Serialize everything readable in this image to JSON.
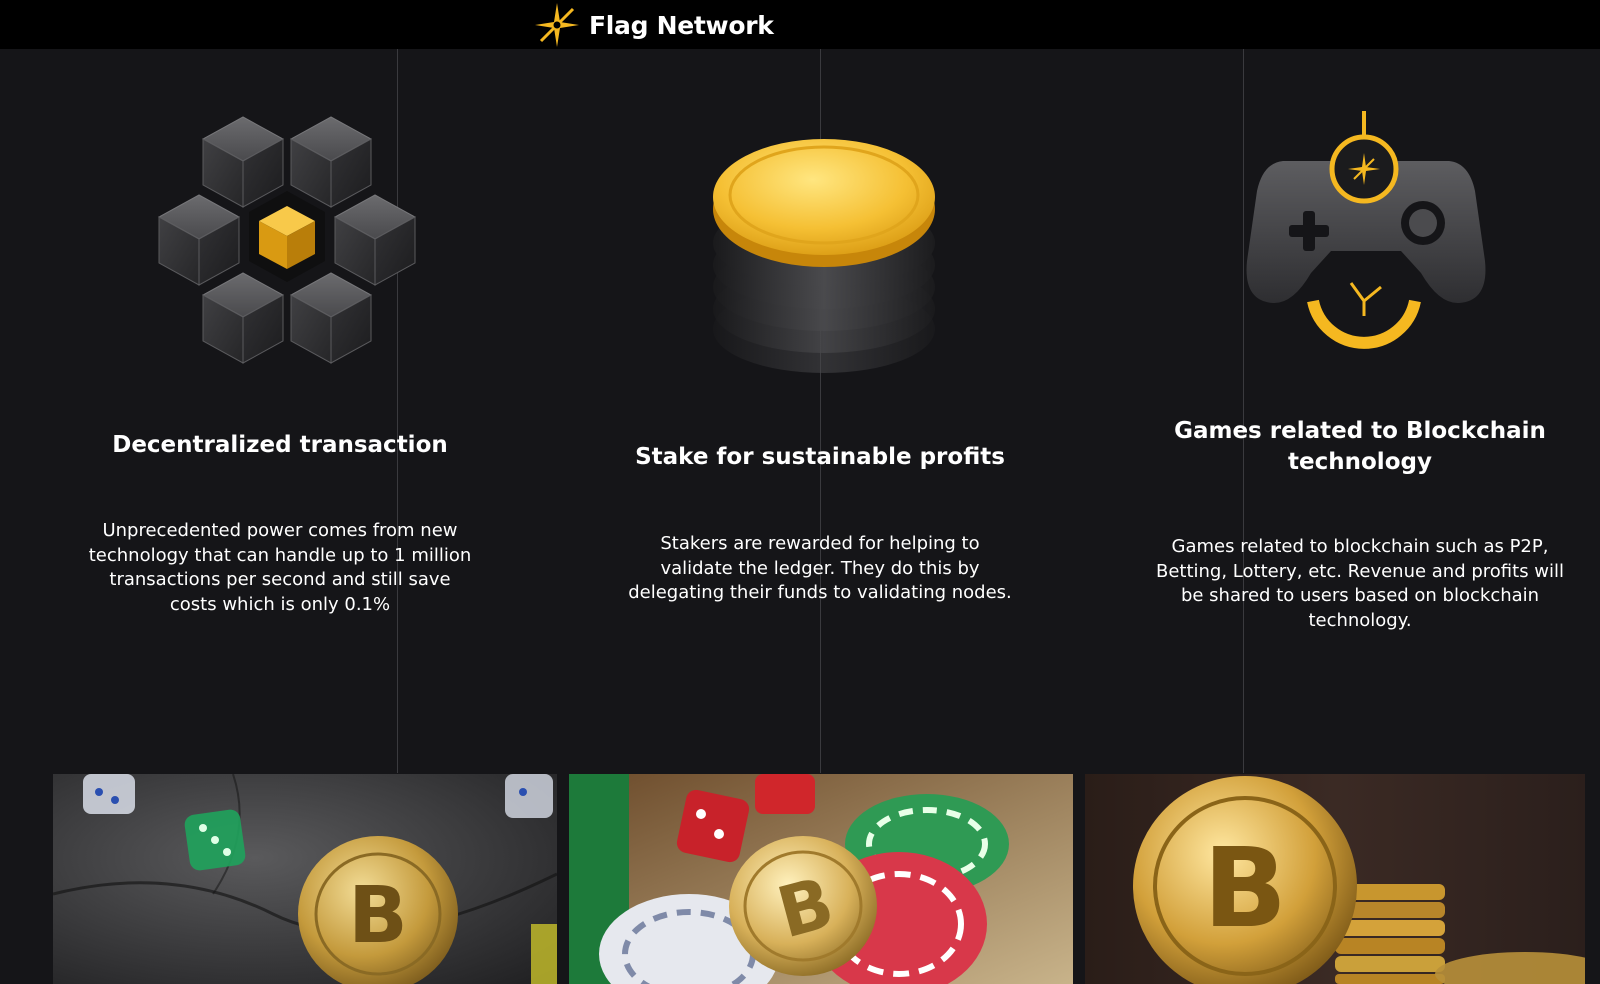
{
  "header": {
    "brand_name": "Flag Network",
    "logo_icon": "flag-network-logo-icon"
  },
  "colors": {
    "background": "#151518",
    "header": "#000000",
    "accent_gold": "#f5b820",
    "text": "#ffffff"
  },
  "features": [
    {
      "icon": "cube-cluster-icon",
      "title": "Decentralized transaction",
      "text": "Unprecedented power comes from new technology that can handle up to 1 million transactions per second and still save costs which is only 0.1%"
    },
    {
      "icon": "coin-stack-icon",
      "title": "Stake for sustainable profits",
      "text": "Stakers are rewarded for helping to validate the ledger. They do this by delegating their funds to validating nodes."
    },
    {
      "icon": "gamepad-icon",
      "title": "Games related to Blockchain technology",
      "text": "Games related to blockchain such as P2P, Betting, Lottery, etc. Revenue and profits will be shared to users based on blockchain technology."
    }
  ],
  "photos": [
    {
      "subject": "dice-and-bitcoin-photo"
    },
    {
      "subject": "casino-chips-and-bitcoin-photo"
    },
    {
      "subject": "bitcoin-coin-stack-photo"
    }
  ]
}
